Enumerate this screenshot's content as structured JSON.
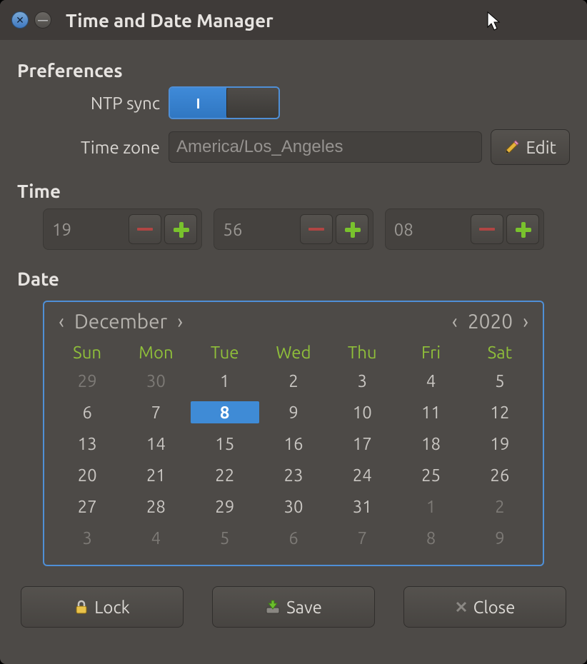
{
  "window": {
    "title": "Time and Date Manager"
  },
  "sections": {
    "preferences": "Preferences",
    "time": "Time",
    "date": "Date"
  },
  "prefs": {
    "ntp_label": "NTP sync",
    "ntp_on_glyph": "I",
    "tz_label": "Time zone",
    "tz_value": "America/Los_Angeles",
    "edit_label": "Edit"
  },
  "time": {
    "hours": "19",
    "minutes": "56",
    "seconds": "08"
  },
  "calendar": {
    "month": "December",
    "year": "2020",
    "dow": [
      "Sun",
      "Mon",
      "Tue",
      "Wed",
      "Thu",
      "Fri",
      "Sat"
    ],
    "selected_day": 8,
    "weeks": [
      [
        {
          "d": 29,
          "out": true
        },
        {
          "d": 30,
          "out": true
        },
        {
          "d": 1
        },
        {
          "d": 2
        },
        {
          "d": 3
        },
        {
          "d": 4
        },
        {
          "d": 5
        }
      ],
      [
        {
          "d": 6
        },
        {
          "d": 7
        },
        {
          "d": 8
        },
        {
          "d": 9
        },
        {
          "d": 10
        },
        {
          "d": 11
        },
        {
          "d": 12
        }
      ],
      [
        {
          "d": 13
        },
        {
          "d": 14
        },
        {
          "d": 15
        },
        {
          "d": 16
        },
        {
          "d": 17
        },
        {
          "d": 18
        },
        {
          "d": 19
        }
      ],
      [
        {
          "d": 20
        },
        {
          "d": 21
        },
        {
          "d": 22
        },
        {
          "d": 23
        },
        {
          "d": 24
        },
        {
          "d": 25
        },
        {
          "d": 26
        }
      ],
      [
        {
          "d": 27
        },
        {
          "d": 28
        },
        {
          "d": 29
        },
        {
          "d": 30
        },
        {
          "d": 31
        },
        {
          "d": 1,
          "out": true
        },
        {
          "d": 2,
          "out": true
        }
      ],
      [
        {
          "d": 3,
          "out": true
        },
        {
          "d": 4,
          "out": true
        },
        {
          "d": 5,
          "out": true
        },
        {
          "d": 6,
          "out": true
        },
        {
          "d": 7,
          "out": true
        },
        {
          "d": 8,
          "out": true
        },
        {
          "d": 9,
          "out": true
        }
      ]
    ]
  },
  "footer": {
    "lock": "Lock",
    "save": "Save",
    "close": "Close"
  },
  "icons": {
    "close": "✕",
    "minimize": "—",
    "chevron_left": "‹",
    "chevron_right": "›"
  }
}
